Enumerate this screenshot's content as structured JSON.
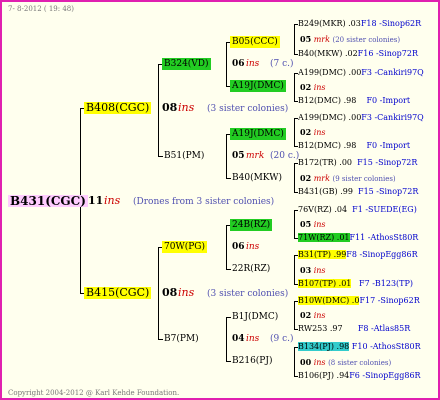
{
  "header": {
    "date": "7- 8-2012 ( 19: 48)"
  },
  "footer": {
    "copyright": "Copyright 2004-2012 @ Karl Kehde Foundation."
  },
  "colors": {
    "frame": "#e020b0",
    "background": "#ffffee",
    "yellow": "#ffff00",
    "green": "#22cc22",
    "pink": "#ffccff",
    "cyan": "#33cccc",
    "blue": "#0000cc",
    "red": "#cc0000"
  },
  "root": {
    "name": "B431(CGC)",
    "gen": "11",
    "ins": "ins",
    "note": "(Drones from 3 sister colonies)"
  },
  "gen1": [
    {
      "name": "B408(CGC)",
      "gen": "08",
      "ins": "ins",
      "note": "(3 sister colonies)"
    },
    {
      "name": "B415(CGC)",
      "gen": "08",
      "ins": "ins",
      "note": "(3 sister colonies)"
    }
  ],
  "gen2": [
    {
      "name": "B324(VD)"
    },
    {
      "name": "B51(PM)"
    },
    {
      "name": "70W(PG)"
    },
    {
      "name": "B7(PM)"
    }
  ],
  "gen3": [
    {
      "name": "B05(CCC)",
      "gen": "06",
      "ins": "ins",
      "note": "(7 c.)"
    },
    {
      "name": "A19J(DMC)"
    },
    {
      "name": "A19J(DMC)",
      "gen": "05",
      "ins": "mrk",
      "note": "(20 c.)"
    },
    {
      "name": "B40(MKW)"
    },
    {
      "name": "24B(RZ)",
      "gen": "06",
      "ins": "ins",
      "note": ""
    },
    {
      "name": "22R(RZ)"
    },
    {
      "name": "B1J(DMC)",
      "gen": "04",
      "ins": "ins",
      "note": "(9 c.)"
    },
    {
      "name": "B216(PJ)"
    }
  ],
  "gen4": [
    {
      "top": "B249(MKR) .03",
      "top_ref": "F18 -Sinop62R",
      "mid_gen": "05",
      "mid_ins": "mrk",
      "mid_note": "(20 sister colonies)",
      "bot": "B40(MKW) .02",
      "bot_ref": "F16 -Sinop72R"
    },
    {
      "top": "A199(DMC) .00",
      "top_ref": "F3 -Cankiri97Q",
      "mid_gen": "02",
      "mid_ins": "ins",
      "mid_note": "",
      "bot": "B12(DMC) .98",
      "bot_ref": "F0 -Import"
    },
    {
      "top": "A199(DMC) .00",
      "top_ref": "F3 -Cankiri97Q",
      "mid_gen": "02",
      "mid_ins": "ins",
      "mid_note": "",
      "bot": "B12(DMC) .98",
      "bot_ref": "F0 -Import"
    },
    {
      "top": "B172(TR) .00",
      "top_ref": "F15 -Sinop72R",
      "mid_gen": "02",
      "mid_ins": "mrk",
      "mid_note": "(9 sister colonies)",
      "bot": "B431(GB) .99",
      "bot_ref": "F15 -Sinop72R"
    },
    {
      "top": "76V(RZ) .04",
      "top_ref": "F1 -SUEDE(EG)",
      "mid_gen": "05",
      "mid_ins": "ins",
      "mid_note": "",
      "bot": "71W(RZ) .01",
      "bot_ref": "F11 -AthosSt80R"
    },
    {
      "top": "B31(TP) .99",
      "top_ref": "F8 -SinopEgg86R",
      "mid_gen": "03",
      "mid_ins": "ins",
      "mid_note": "",
      "bot": "B107(TP) .01",
      "bot_ref": "F7 -B123(TP)"
    },
    {
      "top": "B10W(DMC) .0",
      "top_ref": "F17 -Sinop62R",
      "mid_gen": "02",
      "mid_ins": "ins",
      "mid_note": "",
      "bot": "RW253 .97",
      "bot_ref": "F8 -Atlas85R"
    },
    {
      "top": "B134(PJ) .98",
      "top_ref": "F10 -AthosSt80R",
      "mid_gen": "00",
      "mid_ins": "ins",
      "mid_note": "(8 sister colonies)",
      "bot": "B106(PJ) .94",
      "bot_ref": "F6 -SinopEgg86R"
    }
  ]
}
